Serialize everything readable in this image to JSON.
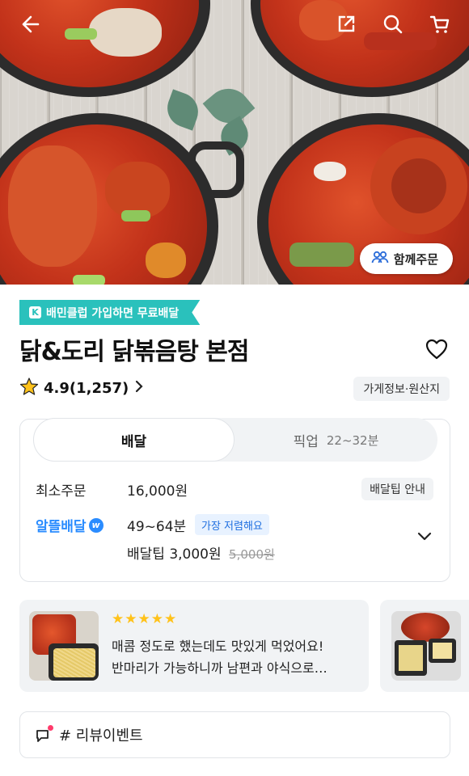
{
  "hero": {
    "share_order_label": "함께주문"
  },
  "store": {
    "promo_banner": "배민클럽 가입하면 무료배달",
    "name": "닭&도리 닭볶음탕 본점",
    "rating": "4.9(1,257)",
    "info_chip": "가게정보·원산지"
  },
  "delivery": {
    "tabs": [
      {
        "label": "배달"
      },
      {
        "label": "픽업",
        "time": "22~32분"
      }
    ],
    "min_order_label": "최소주문",
    "min_order_value": "16,000원",
    "tip_guide": "배달팁 안내",
    "saver_logo_text": "알뜰배달",
    "delivery_time": "49~64분",
    "cheapest_badge": "가장 저렴해요",
    "tip_label": "배달팁 3,000원",
    "tip_original": "5,000원"
  },
  "review": {
    "stars": "★★★★★",
    "line1": "매콤 정도로 했는데도 맛있게 먹었어요!",
    "line2": "반마리가 가능하니까 남편과 야식으로…"
  },
  "event": {
    "label": "# 리뷰이벤트"
  },
  "colors": {
    "brand_mint": "#2ac1bc",
    "saver_blue": "#2a8cff",
    "star_yellow": "#ffc21a"
  },
  "icons": [
    "back-arrow-icon",
    "share-icon",
    "search-icon",
    "cart-icon",
    "group-icon",
    "heart-icon",
    "star-icon",
    "chevron-right-icon",
    "chevron-down-icon",
    "megaphone-icon"
  ]
}
